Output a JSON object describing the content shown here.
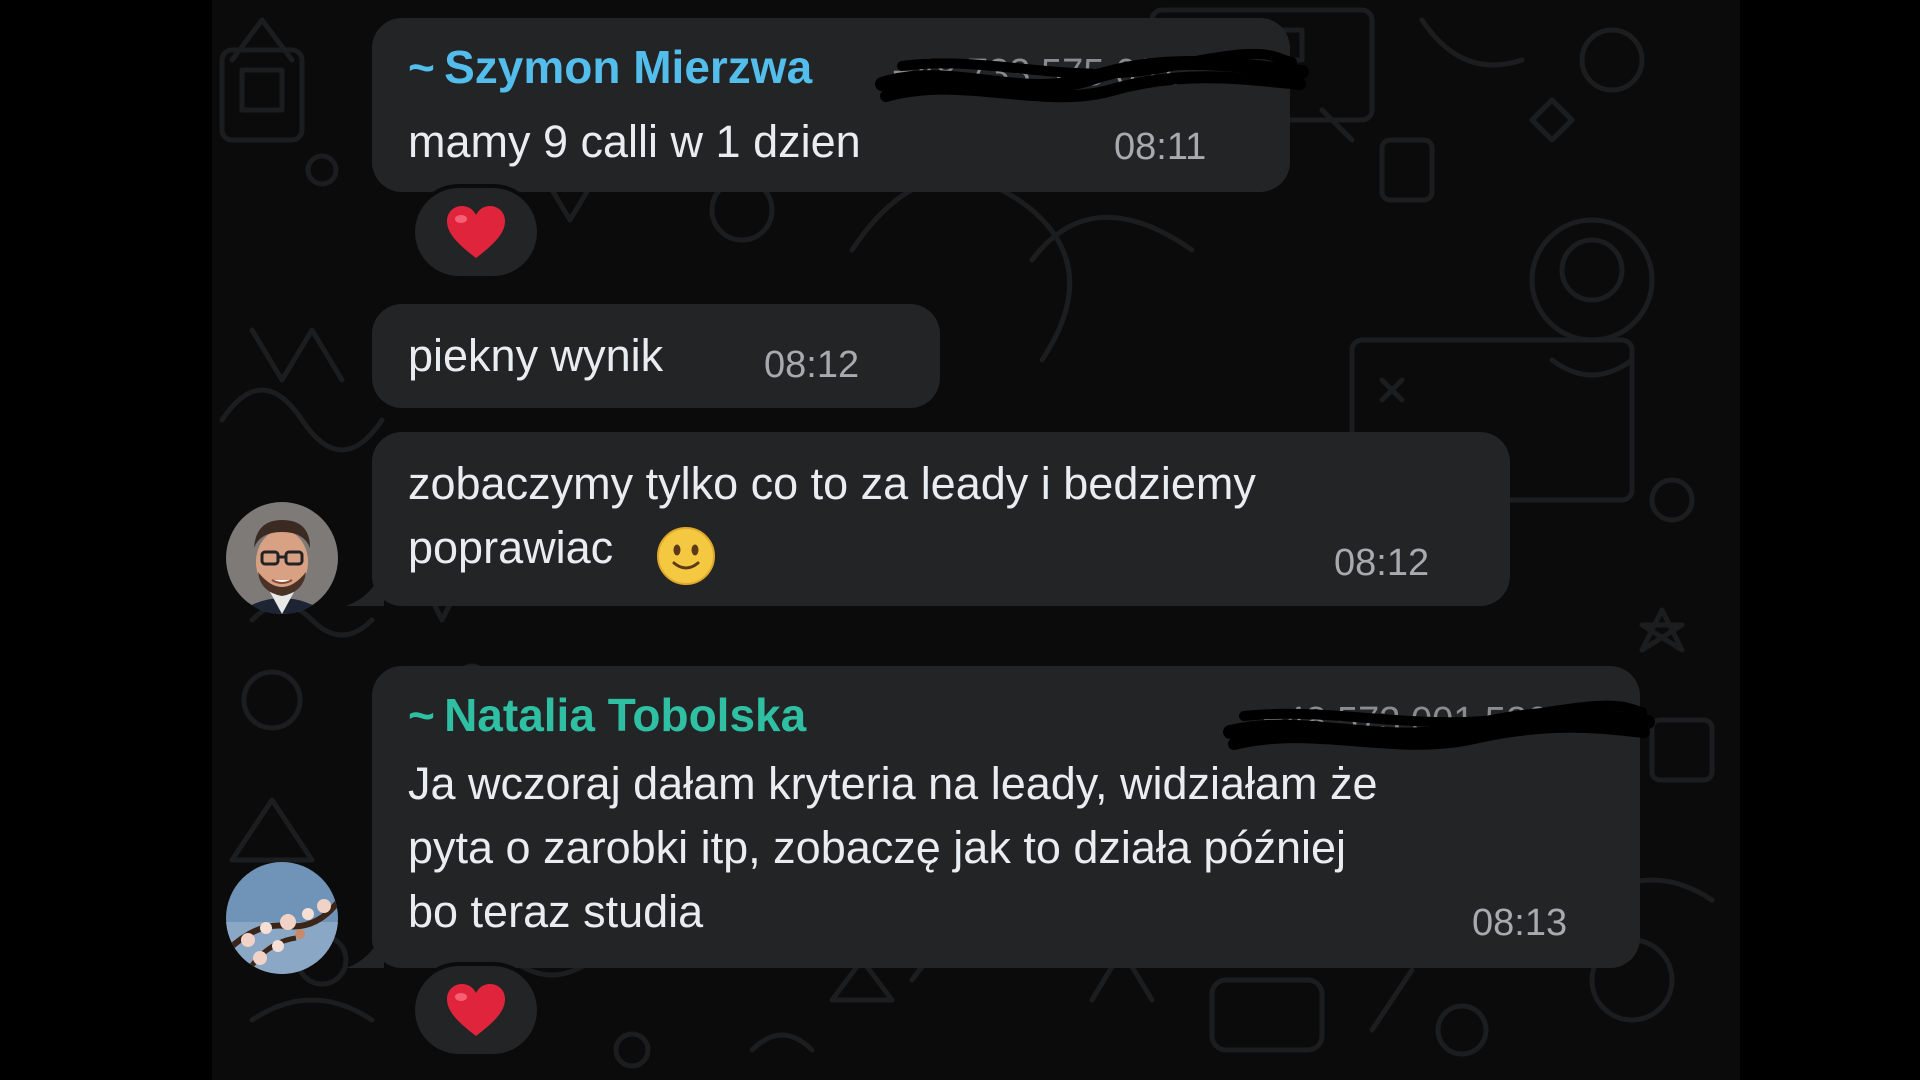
{
  "colors": {
    "chat_background": "#0b0b0c",
    "bubble": "#222426",
    "sender_szymon": "#53bdeb",
    "sender_natalia": "#2fc0a3",
    "timestamp": "#a7abae",
    "heart": "#e0243b",
    "smiley": "#f5c842"
  },
  "messages": [
    {
      "sender": "~ Szymon Mierzwa",
      "phone_redacted": "+48 733 575 631",
      "text": "mamy 9 calli w 1 dzien",
      "time": "08:11",
      "reaction_icon": "red-heart-icon"
    },
    {
      "text": "piekny wynik",
      "time": "08:12"
    },
    {
      "text": "zobaczymy tylko co to za leady i bedziemy\npoprawiac",
      "emoji_icon": "slightly-smiling-face-icon",
      "time": "08:12",
      "avatar_icon": "man-with-glasses-avatar-icon"
    },
    {
      "sender": "~ Natalia Tobolska",
      "phone_redacted": "+48 573 001 580",
      "text": "Ja wczoraj dałam kryteria na leady, widziałam że\npyta o zarobki itp, zobaczę jak to działa później\nbo teraz studia",
      "time": "08:13",
      "avatar_icon": "blossom-branch-avatar-icon",
      "reaction_icon": "red-heart-icon"
    }
  ]
}
